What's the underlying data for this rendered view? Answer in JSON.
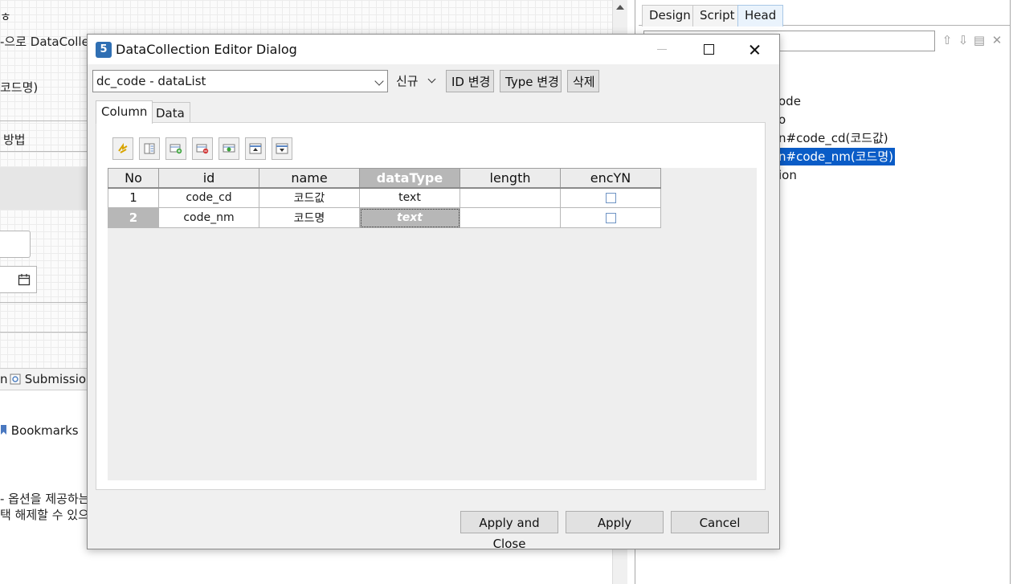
{
  "background_editor": {
    "text_lines": [
      "ㅎ",
      "-으로 DataColle",
      "코드명)",
      "방법"
    ],
    "bottom_tabs": [
      "n",
      "Submission"
    ],
    "bookmarks_label": "Bookmarks",
    "bottom_text": [
      "- 옵션을 제공하는",
      "택 해제할 수 있으"
    ]
  },
  "properties_panel": {
    "tabs": [
      "Design",
      "Script",
      "Head"
    ],
    "active_tab": "Head",
    "search": {
      "value": "",
      "placeholder": ""
    },
    "tree": [
      {
        "label": "ode",
        "selected": false
      },
      {
        "label": "o",
        "selected": false
      },
      {
        "label": "n#code_cd(코드값)",
        "selected": false
      },
      {
        "label": "n#code_nm(코드명)",
        "selected": true
      },
      {
        "label": "ion",
        "selected": false
      }
    ]
  },
  "dialog": {
    "title": "DataCollection Editor Dialog",
    "app_icon": "5",
    "collection_select": {
      "value": "dc_code - dataList"
    },
    "new_menu": "신규",
    "buttons": {
      "change_id": "ID 변경",
      "change_type": "Type 변경",
      "delete": "삭제"
    },
    "tabs": [
      "Column",
      "Data"
    ],
    "active_tab": "Column",
    "toolbar_icons": [
      "refresh-icon",
      "column-list-icon",
      "add-column-icon",
      "remove-column-icon",
      "edit-column-icon",
      "move-up-icon",
      "move-down-icon"
    ],
    "grid": {
      "columns": [
        "No",
        "id",
        "name",
        "dataType",
        "length",
        "encYN"
      ],
      "selected_column": "dataType",
      "rows": [
        {
          "no": "1",
          "id": "code_cd",
          "name": "코드값",
          "dataType": "text",
          "length": "",
          "encYN": false
        },
        {
          "no": "2",
          "id": "code_nm",
          "name": "코드명",
          "dataType": "text",
          "length": "",
          "encYN": false
        }
      ],
      "selected_row": 2
    },
    "footer": {
      "apply_close": "Apply and Close",
      "apply": "Apply",
      "cancel": "Cancel"
    }
  }
}
